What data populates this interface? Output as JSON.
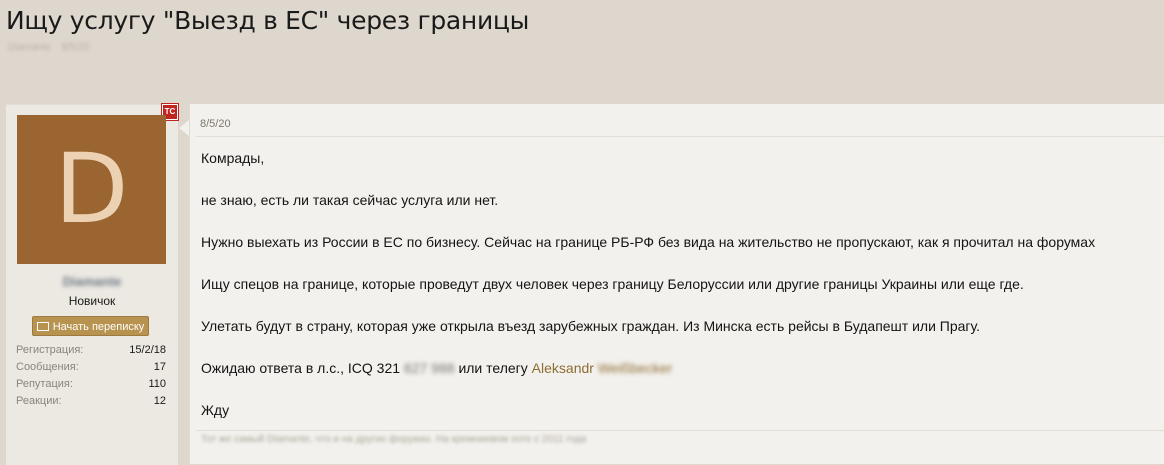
{
  "thread": {
    "title": "Ищу услугу \"Выезд в ЕС\" через границы",
    "meta_author": "Diamante",
    "meta_date": "8/5/20"
  },
  "user": {
    "badge": "TC",
    "avatar_letter": "D",
    "avatar_color": "#9a6531",
    "name": "Diamante",
    "title": "Новичок",
    "start_conversation": "Начать переписку",
    "stats": [
      {
        "label": "Регистрация:",
        "value": "15/2/18"
      },
      {
        "label": "Сообщения:",
        "value": "17"
      },
      {
        "label": "Репутация:",
        "value": "110"
      },
      {
        "label": "Реакции:",
        "value": "12"
      }
    ]
  },
  "post": {
    "date": "8/5/20",
    "p1": "Комрады,",
    "p2": "не знаю, есть ли такая сейчас услуга или нет.",
    "p3": "Нужно выехать из России в ЕС по бизнесу. Сейчас на границе РБ-РФ без вида на жительство не пропускают, как я прочитал на форумах",
    "p4": "Ищу спецов на границе, которые проведут двух человек через границу Белоруссии или другие границы Украины или еще где.",
    "p5": "Улетать будут в страну, которая уже открыла въезд зарубежных граждан. Из Минска есть рейсы в Будапешт или Прагу.",
    "p6_prefix": "Ожидаю ответа в л.с., ICQ 321",
    "p6_icq_hidden": "627 988",
    "p6_mid": "или телегу",
    "p6_contact_first": "Aleksandr",
    "p6_contact_hidden": "Weißbecker",
    "p7": "Жду",
    "signature": "Тот же самый Diamante, что и на других форумах. На кремниевом хоте с 2011 года"
  }
}
